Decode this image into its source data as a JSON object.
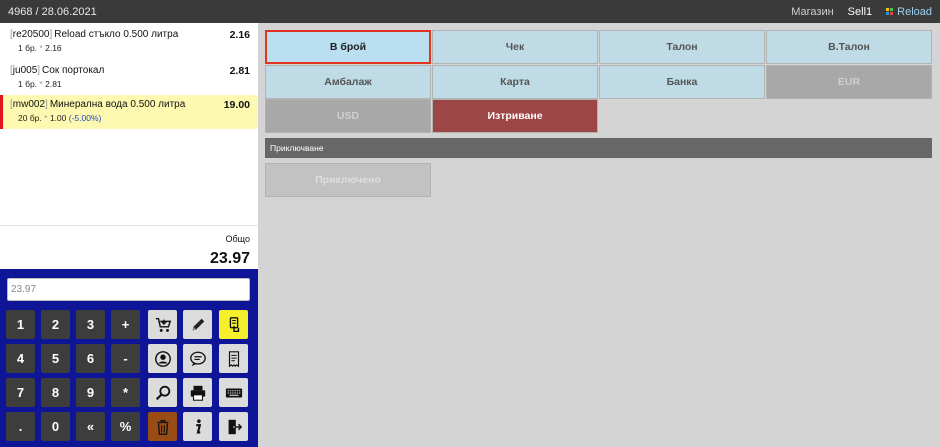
{
  "topbar": {
    "doc_info": "4968 / 28.06.2021",
    "store_label": "Магазин",
    "sell_label": "Sell1",
    "reload_label": "Reload"
  },
  "items": [
    {
      "code": "re20500",
      "name": "Reload стъкло 0.500 литра",
      "price": "2.16",
      "qty": "1 бр.",
      "unit_price": "2.16",
      "discount": ""
    },
    {
      "code": "ju005",
      "name": "Сок портокал",
      "price": "2.81",
      "qty": "1 бр.",
      "unit_price": "2.81",
      "discount": ""
    },
    {
      "code": "mw002",
      "name": "Минерална вода 0.500 литра",
      "price": "19.00",
      "qty": "20 бр.",
      "unit_price": "1.00",
      "discount": "(-5.00%)"
    }
  ],
  "totals": {
    "label": "Общо",
    "value": "23.97"
  },
  "keypad": {
    "input_value": "23.97",
    "keys": [
      "1",
      "2",
      "3",
      "+",
      "4",
      "5",
      "6",
      "-",
      "7",
      "8",
      "9",
      "*",
      ".",
      "0",
      "«",
      "%"
    ]
  },
  "payment": {
    "buttons": [
      "В брой",
      "Чек",
      "Талон",
      "В.Талон",
      "Амбалаж",
      "Карта",
      "Банка",
      "EUR",
      "USD",
      "Изтриване"
    ],
    "section_label": "Приключване",
    "done_label": "Приключено"
  },
  "colors": {
    "accent_red": "#e0341e",
    "keypad_bg": "#0f1597",
    "selected_row": "#fdf9b0"
  }
}
